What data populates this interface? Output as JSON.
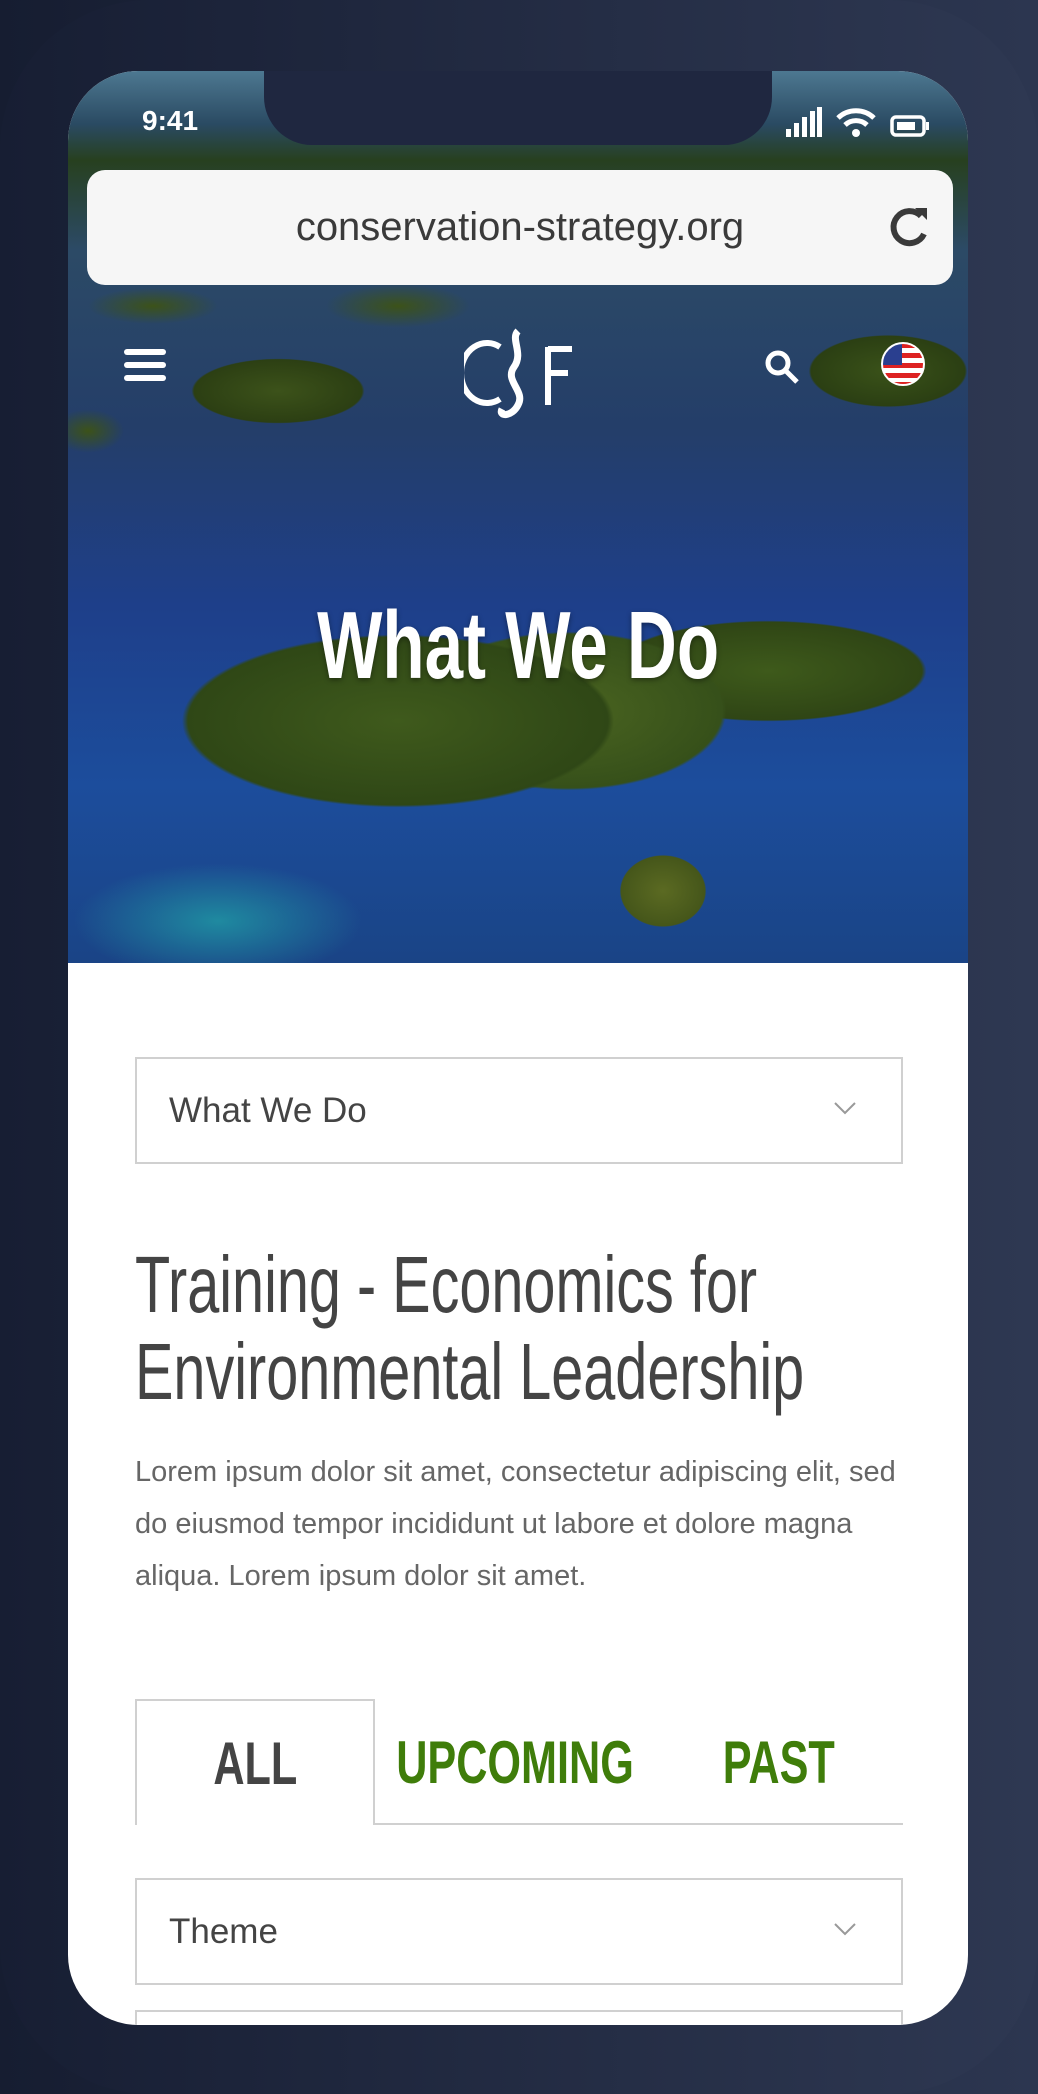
{
  "status": {
    "time": "9:41"
  },
  "browser": {
    "url": "conservation-strategy.org"
  },
  "site": {
    "logo_text": "CSF",
    "hero_title": "What We Do"
  },
  "section_select": {
    "value": "What We Do"
  },
  "content": {
    "heading": "Training - Economics for Environmental Leadership",
    "body": "Lorem ipsum dolor sit amet, consectetur adipiscing elit, sed do eiusmod tempor incididunt ut labore et dolore magna aliqua. Lorem ipsum dolor sit amet."
  },
  "tabs": [
    {
      "label": "ALL",
      "active": true
    },
    {
      "label": "UPCOMING",
      "active": false
    },
    {
      "label": "PAST",
      "active": false
    }
  ],
  "filters": {
    "theme": "Theme"
  },
  "colors": {
    "accent": "#3f7d0a",
    "text": "#444444"
  }
}
